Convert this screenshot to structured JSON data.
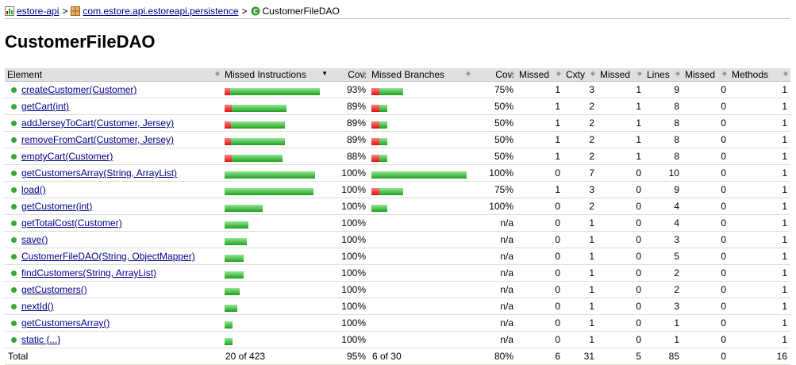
{
  "breadcrumb": {
    "project": "estore-api",
    "package": "com.estore.api.estoreapi.persistence",
    "current": "CustomerFileDAO",
    "separator": ">"
  },
  "page_title": "CustomerFileDAO",
  "table": {
    "headers": {
      "element": "Element",
      "missed_instructions": "Missed Instructions",
      "cov1": "Cov.",
      "missed_branches": "Missed Branches",
      "cov2": "Cov.",
      "missed_cxty": "Missed",
      "cxty": "Cxty",
      "missed_lines": "Missed",
      "lines": "Lines",
      "missed_methods": "Missed",
      "methods": "Methods"
    },
    "rows": [
      {
        "name": "createCustomer(Customer)",
        "instr_missed_frac": 0.06,
        "instr_len": 1.0,
        "instr_cov": "93%",
        "br_missed_frac": 0.25,
        "br_len": 0.33,
        "br_cov": "75%",
        "missed_cxty": "1",
        "cxty": "3",
        "missed_lines": "1",
        "lines": "9",
        "missed_methods": "0",
        "methods": "1"
      },
      {
        "name": "getCart(int)",
        "instr_missed_frac": 0.11,
        "instr_len": 0.65,
        "instr_cov": "89%",
        "br_missed_frac": 0.5,
        "br_len": 0.17,
        "br_cov": "50%",
        "missed_cxty": "1",
        "cxty": "2",
        "missed_lines": "1",
        "lines": "8",
        "missed_methods": "0",
        "methods": "1"
      },
      {
        "name": "addJerseyToCart(Customer, Jersey)",
        "instr_missed_frac": 0.11,
        "instr_len": 0.63,
        "instr_cov": "89%",
        "br_missed_frac": 0.5,
        "br_len": 0.17,
        "br_cov": "50%",
        "missed_cxty": "1",
        "cxty": "2",
        "missed_lines": "1",
        "lines": "8",
        "missed_methods": "0",
        "methods": "1"
      },
      {
        "name": "removeFromCart(Customer, Jersey)",
        "instr_missed_frac": 0.11,
        "instr_len": 0.63,
        "instr_cov": "89%",
        "br_missed_frac": 0.5,
        "br_len": 0.17,
        "br_cov": "50%",
        "missed_cxty": "1",
        "cxty": "2",
        "missed_lines": "1",
        "lines": "8",
        "missed_methods": "0",
        "methods": "1"
      },
      {
        "name": "emptyCart(Customer)",
        "instr_missed_frac": 0.12,
        "instr_len": 0.61,
        "instr_cov": "88%",
        "br_missed_frac": 0.5,
        "br_len": 0.17,
        "br_cov": "50%",
        "missed_cxty": "1",
        "cxty": "2",
        "missed_lines": "1",
        "lines": "8",
        "missed_methods": "0",
        "methods": "1"
      },
      {
        "name": "getCustomersArray(String, ArrayList)",
        "instr_missed_frac": 0.0,
        "instr_len": 0.95,
        "instr_cov": "100%",
        "br_missed_frac": 0.0,
        "br_len": 1.0,
        "br_cov": "100%",
        "missed_cxty": "0",
        "cxty": "7",
        "missed_lines": "0",
        "lines": "10",
        "missed_methods": "0",
        "methods": "1"
      },
      {
        "name": "load()",
        "instr_missed_frac": 0.0,
        "instr_len": 0.93,
        "instr_cov": "100%",
        "br_missed_frac": 0.25,
        "br_len": 0.33,
        "br_cov": "75%",
        "missed_cxty": "1",
        "cxty": "3",
        "missed_lines": "0",
        "lines": "9",
        "missed_methods": "0",
        "methods": "1"
      },
      {
        "name": "getCustomer(int)",
        "instr_missed_frac": 0.0,
        "instr_len": 0.4,
        "instr_cov": "100%",
        "br_missed_frac": 0.0,
        "br_len": 0.17,
        "br_cov": "100%",
        "missed_cxty": "0",
        "cxty": "2",
        "missed_lines": "0",
        "lines": "4",
        "missed_methods": "0",
        "methods": "1"
      },
      {
        "name": "getTotalCost(Customer)",
        "instr_missed_frac": 0.0,
        "instr_len": 0.25,
        "instr_cov": "100%",
        "br_missed_frac": 0.0,
        "br_len": 0.0,
        "br_cov": "n/a",
        "missed_cxty": "0",
        "cxty": "1",
        "missed_lines": "0",
        "lines": "4",
        "missed_methods": "0",
        "methods": "1"
      },
      {
        "name": "save()",
        "instr_missed_frac": 0.0,
        "instr_len": 0.23,
        "instr_cov": "100%",
        "br_missed_frac": 0.0,
        "br_len": 0.0,
        "br_cov": "n/a",
        "missed_cxty": "0",
        "cxty": "1",
        "missed_lines": "0",
        "lines": "3",
        "missed_methods": "0",
        "methods": "1"
      },
      {
        "name": "CustomerFileDAO(String, ObjectMapper)",
        "instr_missed_frac": 0.0,
        "instr_len": 0.2,
        "instr_cov": "100%",
        "br_missed_frac": 0.0,
        "br_len": 0.0,
        "br_cov": "n/a",
        "missed_cxty": "0",
        "cxty": "1",
        "missed_lines": "0",
        "lines": "5",
        "missed_methods": "0",
        "methods": "1"
      },
      {
        "name": "findCustomers(String, ArrayList)",
        "instr_missed_frac": 0.0,
        "instr_len": 0.2,
        "instr_cov": "100%",
        "br_missed_frac": 0.0,
        "br_len": 0.0,
        "br_cov": "n/a",
        "missed_cxty": "0",
        "cxty": "1",
        "missed_lines": "0",
        "lines": "2",
        "missed_methods": "0",
        "methods": "1"
      },
      {
        "name": "getCustomers()",
        "instr_missed_frac": 0.0,
        "instr_len": 0.16,
        "instr_cov": "100%",
        "br_missed_frac": 0.0,
        "br_len": 0.0,
        "br_cov": "n/a",
        "missed_cxty": "0",
        "cxty": "1",
        "missed_lines": "0",
        "lines": "2",
        "missed_methods": "0",
        "methods": "1"
      },
      {
        "name": "nextId()",
        "instr_missed_frac": 0.0,
        "instr_len": 0.13,
        "instr_cov": "100%",
        "br_missed_frac": 0.0,
        "br_len": 0.0,
        "br_cov": "n/a",
        "missed_cxty": "0",
        "cxty": "1",
        "missed_lines": "0",
        "lines": "3",
        "missed_methods": "0",
        "methods": "1"
      },
      {
        "name": "getCustomersArray()",
        "instr_missed_frac": 0.0,
        "instr_len": 0.08,
        "instr_cov": "100%",
        "br_missed_frac": 0.0,
        "br_len": 0.0,
        "br_cov": "n/a",
        "missed_cxty": "0",
        "cxty": "1",
        "missed_lines": "0",
        "lines": "1",
        "missed_methods": "0",
        "methods": "1"
      },
      {
        "name": "static {...}",
        "instr_missed_frac": 0.0,
        "instr_len": 0.08,
        "instr_cov": "100%",
        "br_missed_frac": 0.0,
        "br_len": 0.0,
        "br_cov": "n/a",
        "missed_cxty": "0",
        "cxty": "1",
        "missed_lines": "0",
        "lines": "1",
        "missed_methods": "0",
        "methods": "1"
      }
    ],
    "total": {
      "label": "Total",
      "instructions": "20 of 423",
      "instr_cov": "95%",
      "branches": "6 of 30",
      "br_cov": "80%",
      "missed_cxty": "6",
      "cxty": "31",
      "missed_lines": "5",
      "lines": "85",
      "missed_methods": "0",
      "methods": "16"
    }
  },
  "colors": {
    "missed": "#e01010",
    "covered": "#20a020",
    "link": "#000088",
    "header_bg": "#e0e0e0"
  }
}
